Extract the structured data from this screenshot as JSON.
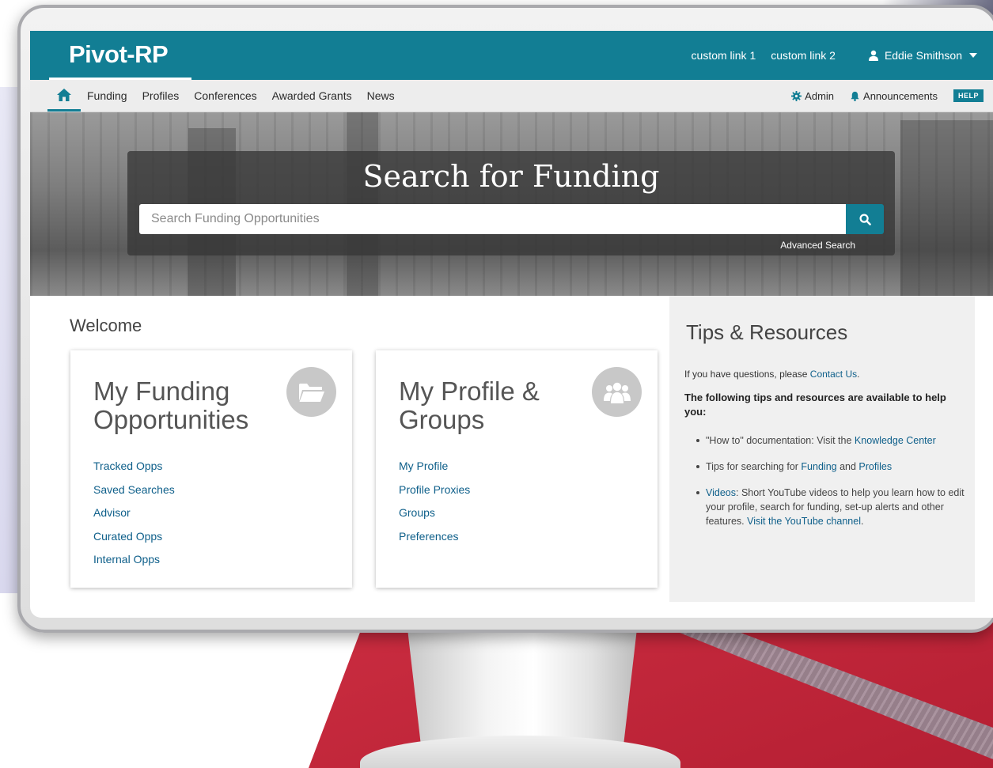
{
  "header": {
    "logo": "Pivot-RP",
    "custom_link_1": "custom link 1",
    "custom_link_2": "custom link 2",
    "user_name": "Eddie Smithson"
  },
  "nav": {
    "items": [
      "Funding",
      "Profiles",
      "Conferences",
      "Awarded Grants",
      "News"
    ],
    "admin": "Admin",
    "announcements": "Announcements",
    "help": "HELP"
  },
  "hero": {
    "title": "Search for Funding",
    "search_placeholder": "Search Funding Opportunities",
    "advanced_search": "Advanced Search"
  },
  "welcome": "Welcome",
  "cards": [
    {
      "title": "My Funding Opportunities",
      "icon": "folder-open-icon",
      "links": [
        "Tracked Opps",
        "Saved Searches",
        "Advisor",
        "Curated Opps",
        "Internal Opps"
      ]
    },
    {
      "title": "My Profile & Groups",
      "icon": "users-icon",
      "links": [
        "My Profile",
        "Profile Proxies",
        "Groups",
        "Preferences"
      ]
    }
  ],
  "tips": {
    "title": "Tips & Resources",
    "intro_text": "If you have questions, please ",
    "intro_link": "Contact Us",
    "intro_end": ".",
    "lead": "The following tips and resources are available to help you:",
    "item1_text": "\"How to\" documentation: Visit the ",
    "item1_link": "Knowledge Center",
    "item2_text": "Tips for searching for ",
    "item2_link1": "Funding",
    "item2_and": " and ",
    "item2_link2": "Profiles",
    "item3_link1": "Videos",
    "item3_text": ": Short YouTube videos to help you learn how to edit your profile, search for funding, set-up alerts and other features. ",
    "item3_link2": "Visit the YouTube channel",
    "item3_end": "."
  },
  "colors": {
    "brand": "#127e94",
    "link": "#0e5f8a",
    "backdrop_red": "#d63447"
  }
}
